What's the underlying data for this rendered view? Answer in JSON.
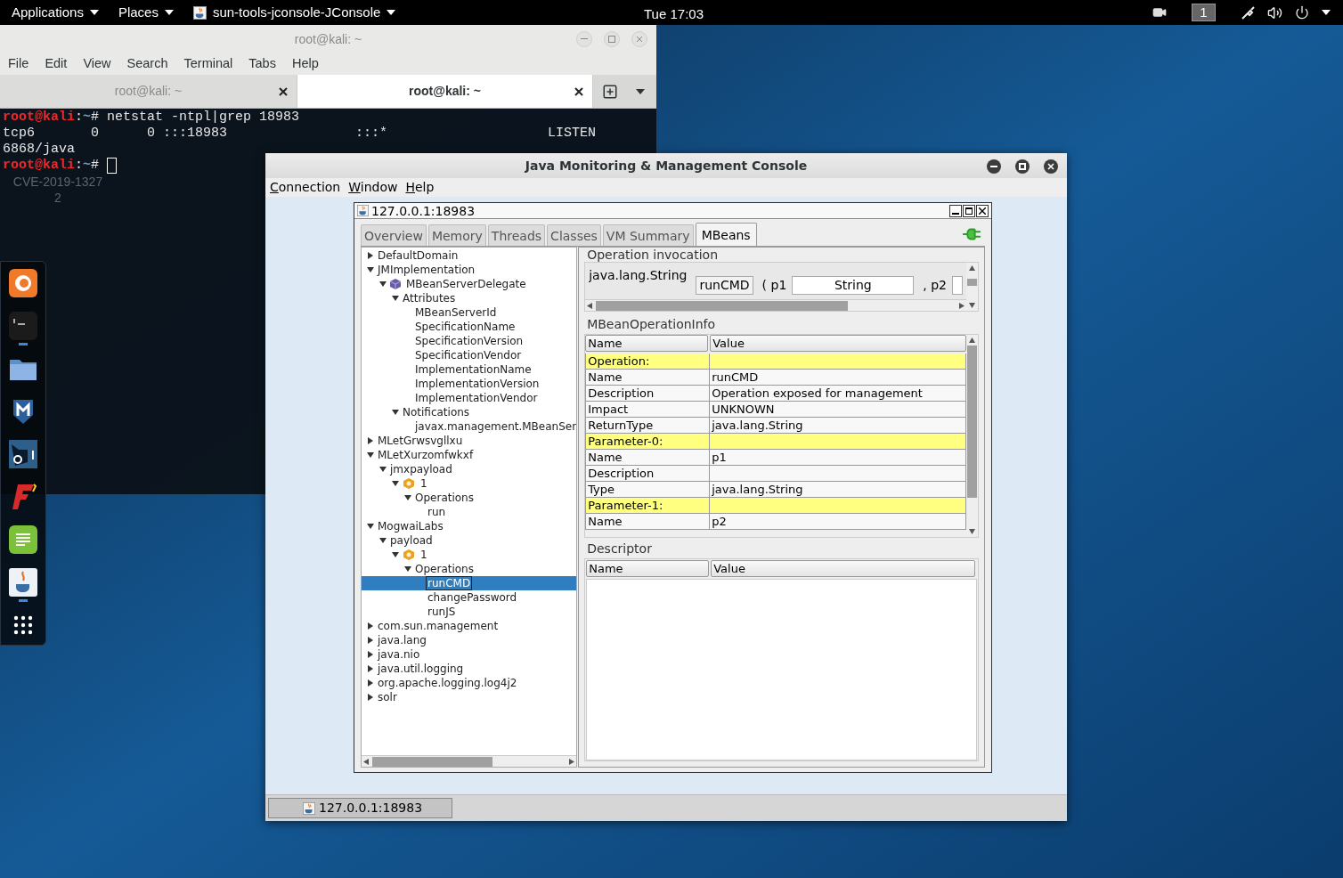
{
  "top_bar": {
    "menus": [
      {
        "label": "Applications",
        "kind": "menu"
      },
      {
        "label": "Places",
        "kind": "menu"
      },
      {
        "label": "sun-tools-jconsole-JConsole",
        "kind": "app"
      }
    ],
    "clock": "Tue 17:03",
    "workspace": "1"
  },
  "terminal": {
    "title": "root@kali: ~",
    "menu": [
      "File",
      "Edit",
      "View",
      "Search",
      "Terminal",
      "Tabs",
      "Help"
    ],
    "tabs": [
      {
        "label": "root@kali: ~",
        "selected": false
      },
      {
        "label": "root@kali: ~",
        "selected": true
      }
    ],
    "lines": [
      {
        "kind": "prompt",
        "user": "root@kali",
        "separator": ":",
        "path": "~",
        "symbol": "#",
        "command": "netstat -ntpl|grep 18983"
      },
      {
        "kind": "output",
        "text": "tcp6       0      0 :::18983                :::*                    LISTEN"
      },
      {
        "kind": "output",
        "text": "6868/java"
      },
      {
        "kind": "prompt",
        "user": "root@kali",
        "separator": ":",
        "path": "~",
        "symbol": "#",
        "cursor": true
      }
    ]
  },
  "desktop_label": [
    "CVE-2019-1327",
    "2"
  ],
  "dock": [
    {
      "kind": "browser",
      "running": false
    },
    {
      "kind": "terminal",
      "running": true
    },
    {
      "kind": "files",
      "running": false
    },
    {
      "kind": "shield",
      "running": false
    },
    {
      "kind": "bull",
      "running": false
    },
    {
      "kind": "red",
      "running": false
    },
    {
      "kind": "notes",
      "running": false
    },
    {
      "kind": "java",
      "running": true
    },
    {
      "kind": "apps",
      "running": false
    }
  ],
  "jconsole": {
    "title": "Java Monitoring & Management Console",
    "menu": [
      "Connection",
      "Window",
      "Help"
    ],
    "frame": {
      "title": "127.0.0.1:18983",
      "tabs": [
        {
          "label": "Overview",
          "selected": false
        },
        {
          "label": "Memory",
          "selected": false
        },
        {
          "label": "Threads",
          "selected": false
        },
        {
          "label": "Classes",
          "selected": false
        },
        {
          "label": "VM Summary",
          "selected": false
        },
        {
          "label": "MBeans",
          "selected": true
        }
      ],
      "tree": [
        {
          "label": "DefaultDomain",
          "kind": "folder",
          "expanded": false,
          "selected": false
        },
        {
          "label": "JMImplementation",
          "kind": "folder",
          "expanded": true,
          "selected": false,
          "children": [
            {
              "label": "MBeanServerDelegate",
              "kind": "mbean",
              "expanded": true,
              "selected": false,
              "children": [
                {
                  "label": "Attributes",
                  "kind": "folder",
                  "expanded": true,
                  "selected": false,
                  "children": [
                    {
                      "label": "MBeanServerId",
                      "kind": "leaf",
                      "selected": false
                    },
                    {
                      "label": "SpecificationName",
                      "kind": "leaf",
                      "selected": false
                    },
                    {
                      "label": "SpecificationVersion",
                      "kind": "leaf",
                      "selected": false
                    },
                    {
                      "label": "SpecificationVendor",
                      "kind": "leaf",
                      "selected": false
                    },
                    {
                      "label": "ImplementationName",
                      "kind": "leaf",
                      "selected": false
                    },
                    {
                      "label": "ImplementationVersion",
                      "kind": "leaf",
                      "selected": false
                    },
                    {
                      "label": "ImplementationVendor",
                      "kind": "leaf",
                      "selected": false
                    }
                  ]
                },
                {
                  "label": "Notifications",
                  "kind": "folder",
                  "expanded": true,
                  "selected": false,
                  "children": [
                    {
                      "label": "javax.management.MBeanSer",
                      "kind": "leaf",
                      "selected": false
                    }
                  ]
                }
              ]
            }
          ]
        },
        {
          "label": "MLetGrwsvgllxu",
          "kind": "folder",
          "expanded": false,
          "selected": false
        },
        {
          "label": "MLetXurzomfwkxf",
          "kind": "folder",
          "expanded": true,
          "selected": false,
          "children": [
            {
              "label": "jmxpayload",
              "kind": "folder",
              "expanded": true,
              "selected": false,
              "children": [
                {
                  "label": "1",
                  "kind": "bean",
                  "expanded": true,
                  "selected": false,
                  "children": [
                    {
                      "label": "Operations",
                      "kind": "folder",
                      "expanded": true,
                      "selected": false,
                      "children": [
                        {
                          "label": "run",
                          "kind": "leaf",
                          "selected": false
                        }
                      ]
                    }
                  ]
                }
              ]
            }
          ]
        },
        {
          "label": "MogwaiLabs",
          "kind": "folder",
          "expanded": true,
          "selected": false,
          "children": [
            {
              "label": "payload",
              "kind": "folder",
              "expanded": true,
              "selected": false,
              "children": [
                {
                  "label": "1",
                  "kind": "bean",
                  "expanded": true,
                  "selected": false,
                  "children": [
                    {
                      "label": "Operations",
                      "kind": "folder",
                      "expanded": true,
                      "selected": false,
                      "children": [
                        {
                          "label": "runCMD",
                          "kind": "leaf",
                          "selected": true
                        },
                        {
                          "label": "changePassword",
                          "kind": "leaf",
                          "selected": false
                        },
                        {
                          "label": "runJS",
                          "kind": "leaf",
                          "selected": false
                        }
                      ]
                    }
                  ]
                }
              ]
            }
          ]
        },
        {
          "label": "com.sun.management",
          "kind": "folder",
          "expanded": false,
          "selected": false
        },
        {
          "label": "java.lang",
          "kind": "folder",
          "expanded": false,
          "selected": false
        },
        {
          "label": "java.nio",
          "kind": "folder",
          "expanded": false,
          "selected": false
        },
        {
          "label": "java.util.logging",
          "kind": "folder",
          "expanded": false,
          "selected": false
        },
        {
          "label": "org.apache.logging.log4j2",
          "kind": "folder",
          "expanded": false,
          "selected": false
        },
        {
          "label": "solr",
          "kind": "folder",
          "expanded": false,
          "selected": false
        }
      ],
      "operation_invocation": {
        "title": "Operation invocation",
        "return_type": "java.lang.String",
        "button": "runCMD",
        "params": [
          {
            "label": "( p1",
            "value": "String"
          },
          {
            "label": ", p2"
          }
        ]
      },
      "operation_info": {
        "title": "MBeanOperationInfo",
        "columns": [
          "Name",
          "Value"
        ],
        "rows": [
          {
            "kind": "section",
            "name": "Operation:"
          },
          {
            "kind": "field",
            "name": "Name",
            "value": "runCMD"
          },
          {
            "kind": "field",
            "name": "Description",
            "value": "Operation exposed for management"
          },
          {
            "kind": "field",
            "name": "Impact",
            "value": "UNKNOWN"
          },
          {
            "kind": "field",
            "name": "ReturnType",
            "value": "java.lang.String"
          },
          {
            "kind": "section",
            "name": "Parameter-0:"
          },
          {
            "kind": "field",
            "name": "Name",
            "value": "p1"
          },
          {
            "kind": "field",
            "name": "Description"
          },
          {
            "kind": "field",
            "name": "Type",
            "value": "java.lang.String"
          },
          {
            "kind": "section",
            "name": "Parameter-1:"
          },
          {
            "kind": "field",
            "name": "Name",
            "value": "p2"
          }
        ]
      },
      "descriptor": {
        "title": "Descriptor",
        "columns": [
          "Name",
          "Value"
        ]
      }
    },
    "taskbar_button": "127.0.0.1:18983"
  }
}
